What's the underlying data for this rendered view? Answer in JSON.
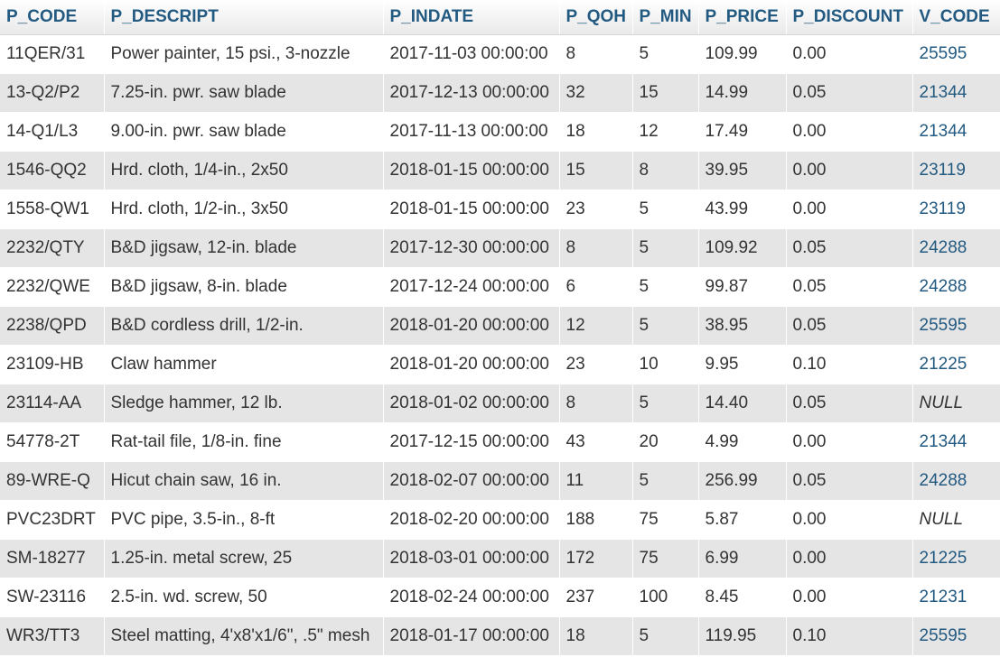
{
  "columns": [
    "P_CODE",
    "P_DESCRIPT",
    "P_INDATE",
    "P_QOH",
    "P_MIN",
    "P_PRICE",
    "P_DISCOUNT",
    "V_CODE"
  ],
  "rows": [
    [
      "11QER/31",
      "Power painter, 15 psi., 3-nozzle",
      "2017-11-03 00:00:00",
      "8",
      "5",
      "109.99",
      "0.00",
      "25595"
    ],
    [
      "13-Q2/P2",
      "7.25-in. pwr. saw blade",
      "2017-12-13 00:00:00",
      "32",
      "15",
      "14.99",
      "0.05",
      "21344"
    ],
    [
      "14-Q1/L3",
      "9.00-in. pwr. saw blade",
      "2017-11-13 00:00:00",
      "18",
      "12",
      "17.49",
      "0.00",
      "21344"
    ],
    [
      "1546-QQ2",
      "Hrd. cloth, 1/4-in., 2x50",
      "2018-01-15 00:00:00",
      "15",
      "8",
      "39.95",
      "0.00",
      "23119"
    ],
    [
      "1558-QW1",
      "Hrd. cloth, 1/2-in., 3x50",
      "2018-01-15 00:00:00",
      "23",
      "5",
      "43.99",
      "0.00",
      "23119"
    ],
    [
      "2232/QTY",
      "B&D jigsaw, 12-in. blade",
      "2017-12-30 00:00:00",
      "8",
      "5",
      "109.92",
      "0.05",
      "24288"
    ],
    [
      "2232/QWE",
      "B&D jigsaw, 8-in. blade",
      "2017-12-24 00:00:00",
      "6",
      "5",
      "99.87",
      "0.05",
      "24288"
    ],
    [
      "2238/QPD",
      "B&D cordless drill, 1/2-in.",
      "2018-01-20 00:00:00",
      "12",
      "5",
      "38.95",
      "0.05",
      "25595"
    ],
    [
      "23109-HB",
      "Claw hammer",
      "2018-01-20 00:00:00",
      "23",
      "10",
      "9.95",
      "0.10",
      "21225"
    ],
    [
      "23114-AA",
      "Sledge hammer, 12 lb.",
      "2018-01-02 00:00:00",
      "8",
      "5",
      "14.40",
      "0.05",
      "NULL"
    ],
    [
      "54778-2T",
      "Rat-tail file, 1/8-in. fine",
      "2017-12-15 00:00:00",
      "43",
      "20",
      "4.99",
      "0.00",
      "21344"
    ],
    [
      "89-WRE-Q",
      "Hicut chain saw, 16 in.",
      "2018-02-07 00:00:00",
      "11",
      "5",
      "256.99",
      "0.05",
      "24288"
    ],
    [
      "PVC23DRT",
      "PVC pipe, 3.5-in., 8-ft",
      "2018-02-20 00:00:00",
      "188",
      "75",
      "5.87",
      "0.00",
      "NULL"
    ],
    [
      "SM-18277",
      "1.25-in. metal screw, 25",
      "2018-03-01 00:00:00",
      "172",
      "75",
      "6.99",
      "0.00",
      "21225"
    ],
    [
      "SW-23116",
      "2.5-in. wd. screw, 50",
      "2018-02-24 00:00:00",
      "237",
      "100",
      "8.45",
      "0.00",
      "21231"
    ],
    [
      "WR3/TT3",
      "Steel matting, 4'x8'x1/6\", .5\" mesh",
      "2018-01-17 00:00:00",
      "18",
      "5",
      "119.95",
      "0.10",
      "25595"
    ]
  ]
}
